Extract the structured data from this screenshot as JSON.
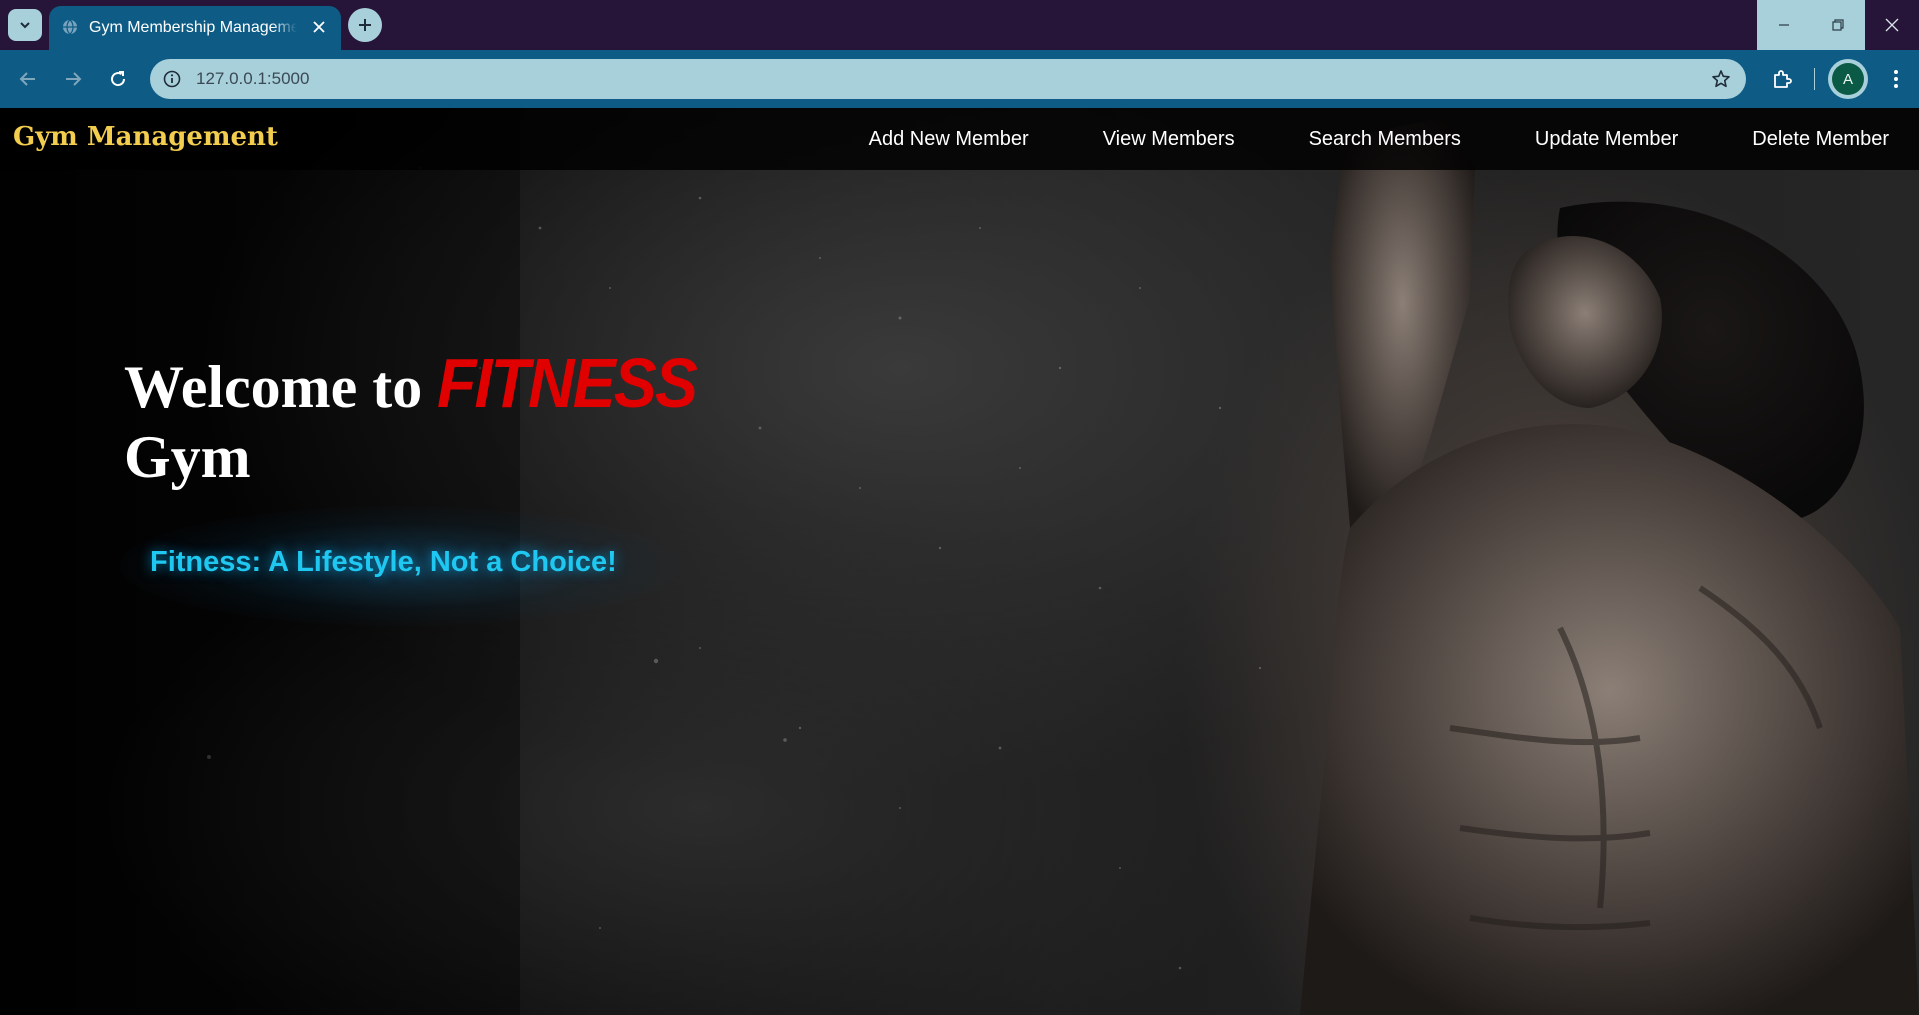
{
  "browser": {
    "tab_title": "Gym Membership Management",
    "url": "127.0.0.1:5000",
    "avatar_letter": "A"
  },
  "navbar": {
    "brand": "Gym Management",
    "links": [
      "Add New Member",
      "View Members",
      "Search Members",
      "Update Member",
      "Delete Member"
    ]
  },
  "hero": {
    "title_prefix": "Welcome to",
    "title_brand": "FITNESS",
    "title_suffix": "Gym",
    "tagline": "Fitness: A Lifestyle, Not a Choice!"
  },
  "colors": {
    "tabstrip": "#261538",
    "toolbar": "#0e5c86",
    "brand": "#f2cd4e",
    "fitness_red": "#e10000",
    "tagline_cyan": "#1ec8f0"
  }
}
